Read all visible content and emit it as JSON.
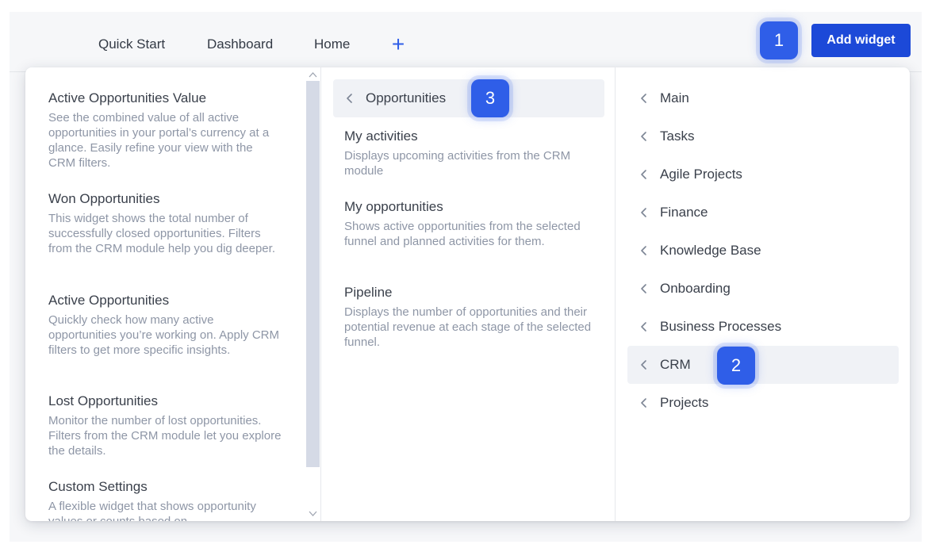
{
  "top_bar": {
    "tabs": [
      "Quick Start",
      "Dashboard",
      "Home"
    ],
    "add_tab_symbol": "+",
    "add_widget_label": "Add widget"
  },
  "badges": [
    "1",
    "2",
    "3"
  ],
  "widgets": [
    {
      "title": "Active Opportunities Value",
      "description": "See the combined value of all active opportunities in your portal’s currency at a glance. Easily refine your view with the CRM filters."
    },
    {
      "title": "Won Opportunities",
      "description": "This widget shows the total number of successfully closed opportunities. Filters from the CRM module help you dig deeper."
    },
    {
      "title": "Active Opportunities",
      "description": "Quickly check how many active opportunities you’re working on. Apply CRM filters to get more specific insights."
    },
    {
      "title": "Lost Opportunities",
      "description": "Monitor the number of lost opportunities. Filters from the CRM module let you explore the details."
    },
    {
      "title": "Custom Settings",
      "description": "A flexible widget that shows opportunity values or counts based on"
    }
  ],
  "submenu": {
    "header": "Opportunities",
    "items": [
      {
        "title": "My activities",
        "description": "Displays upcoming activities from the CRM module"
      },
      {
        "title": "My opportunities",
        "description": "Shows active opportunities from the selected funnel and planned activities for them."
      },
      {
        "title": "Pipeline",
        "description": "Displays the number of opportunities and their potential revenue at each stage of the selected funnel."
      }
    ]
  },
  "categories": [
    "Main",
    "Tasks",
    "Agile Projects",
    "Finance",
    "Knowledge Base",
    "Onboarding",
    "Business Processes",
    "CRM",
    "Projects"
  ],
  "active_category": "CRM",
  "icons": {
    "back": "chevron-left-icon",
    "scroll_up": "scroll-up-arrow-icon",
    "scroll_down": "scroll-down-arrow-icon"
  },
  "colors": {
    "accent": "#1c49d8",
    "badge": "#2f5ee8",
    "active_row": "#f0f2f6",
    "muted_text": "#8e96a6"
  }
}
